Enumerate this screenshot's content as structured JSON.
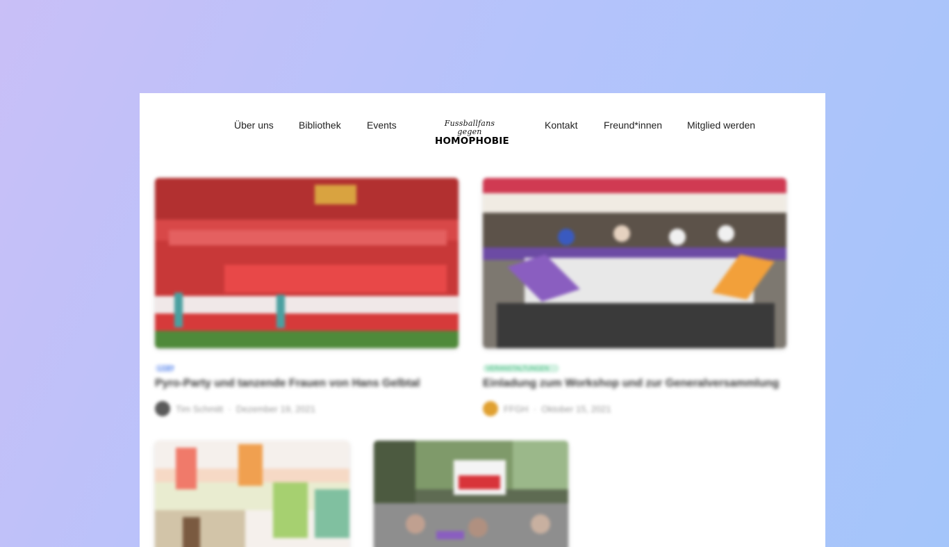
{
  "nav": {
    "left_items": [
      "Über uns",
      "Bibliothek",
      "Events"
    ],
    "right_items": [
      "Kontakt",
      "Freund*innen",
      "Mitglied werden"
    ],
    "logo": {
      "line1": "Fussballfans gegen",
      "line2": "HOMOPHOBIE"
    }
  },
  "posts": [
    {
      "tag": "LGBT",
      "tag_color": "#4a7de8",
      "title": "Pyro-Party und tanzende Frauen von Hans Gelbtal",
      "author": "Tim Schmitt",
      "date": "Dezember 19, 2021",
      "avatar_color": "#555555"
    },
    {
      "tag": "VERANSTALTUNGEN",
      "tag_color": "#3bb87a",
      "title": "Einladung zum Workshop und zur Generalversammlung",
      "author": "FFGH",
      "date": "Oktober 15, 2021",
      "avatar_color": "#e0a030"
    },
    {
      "title": "",
      "author": "",
      "date": ""
    },
    {
      "title": "",
      "author": "",
      "date": ""
    }
  ]
}
